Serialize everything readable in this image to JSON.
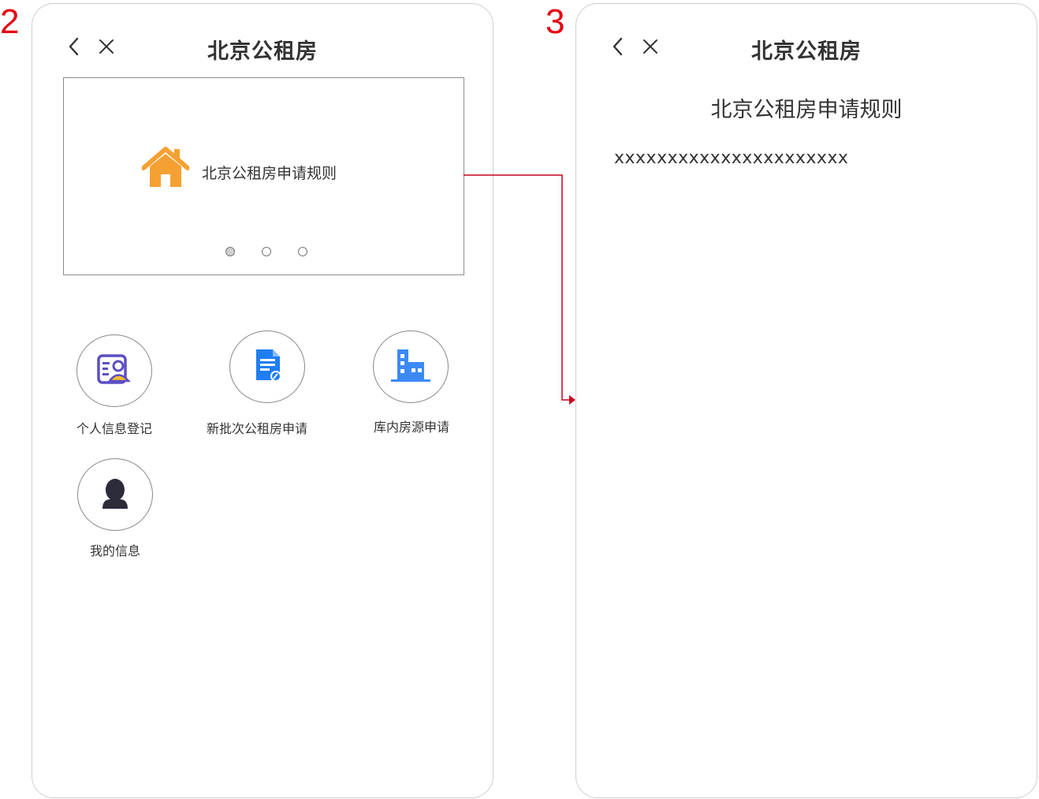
{
  "steps": {
    "left": "2",
    "right": "3"
  },
  "colors": {
    "step_number": "#e60012",
    "connector": "#c8001e",
    "house_icon": "#f5a032",
    "doc_icon": "#1e7ef2",
    "building_icon": "#3d8af7",
    "person_icon": "#2b2b3a"
  },
  "screen_home": {
    "nav": {
      "back_icon": "chevron-left-icon",
      "close_icon": "close-icon",
      "title": "北京公租房"
    },
    "banner": {
      "icon": "house-icon",
      "text": "北京公租房申请规则",
      "dots_total": 3,
      "active_dot": 1
    },
    "menu": [
      {
        "icon": "id-card-icon",
        "label": "个人信息登记"
      },
      {
        "icon": "document-edit-icon",
        "label": "新批次公租房申请"
      },
      {
        "icon": "building-icon",
        "label": "库内房源申请"
      },
      {
        "icon": "user-avatar-icon",
        "label": "我的信息"
      }
    ]
  },
  "screen_rules": {
    "nav": {
      "back_icon": "chevron-left-icon",
      "close_icon": "close-icon",
      "title": "北京公租房"
    },
    "heading": "北京公租房申请规则",
    "body": "xxxxxxxxxxxxxxxxxxxxxx"
  }
}
